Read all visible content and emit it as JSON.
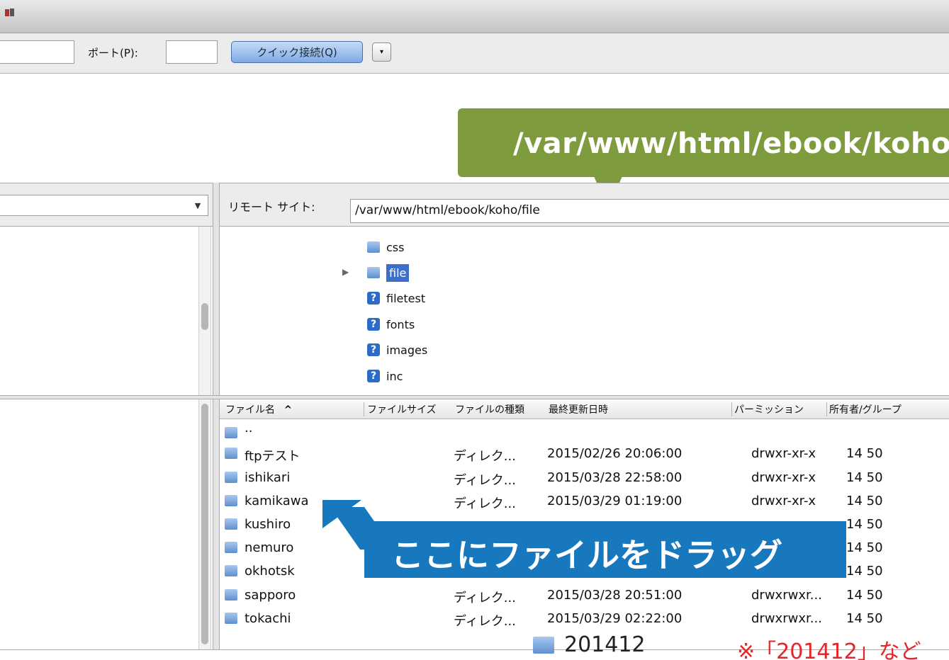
{
  "toolbar": {
    "port_label": "ポート(P):",
    "quickconnect_label": "クイック接続(Q)",
    "dropdown_glyph": "▾"
  },
  "callout_top": {
    "text": "/var/www/html/ebook/koho/"
  },
  "remote_site": {
    "label": "リモート サイト:",
    "path": "/var/www/html/ebook/koho/file"
  },
  "remote_tree": {
    "items": [
      {
        "name": "css",
        "icon": "folder-icon"
      },
      {
        "name": "file",
        "icon": "folder-open-icon",
        "selected": true
      },
      {
        "name": "filetest",
        "icon": "unknown-folder-icon"
      },
      {
        "name": "fonts",
        "icon": "unknown-folder-icon"
      },
      {
        "name": "images",
        "icon": "unknown-folder-icon"
      },
      {
        "name": "inc",
        "icon": "unknown-folder-icon"
      }
    ]
  },
  "columns": {
    "filename": "ファイル名",
    "sort_glyph": "^",
    "filesize": "ファイルサイズ",
    "filetype": "ファイルの種類",
    "modified": "最終更新日時",
    "permission": "パーミッション",
    "owner": "所有者/グループ"
  },
  "files": [
    {
      "name": "..",
      "type": "",
      "modified": "",
      "perm": "",
      "owner": ""
    },
    {
      "name": "ftpテスト",
      "type": "ディレク...",
      "modified": "2015/02/26 20:06:00",
      "perm": "drwxr-xr-x",
      "owner": "14 50"
    },
    {
      "name": "ishikari",
      "type": "ディレク...",
      "modified": "2015/03/28 22:58:00",
      "perm": "drwxr-xr-x",
      "owner": "14 50"
    },
    {
      "name": "kamikawa",
      "type": "ディレク...",
      "modified": "2015/03/29 01:19:00",
      "perm": "drwxr-xr-x",
      "owner": "14 50"
    },
    {
      "name": "kushiro",
      "type": "",
      "modified": "",
      "perm": "",
      "owner": "14 50"
    },
    {
      "name": "nemuro",
      "type": "",
      "modified": "",
      "perm": "",
      "owner": "14 50"
    },
    {
      "name": "okhotsk",
      "type": "",
      "modified": "",
      "perm": "",
      "owner": "14 50"
    },
    {
      "name": "sapporo",
      "type": "ディレク...",
      "modified": "2015/03/28 20:51:00",
      "perm": "drwxrwxr...",
      "owner": "14 50"
    },
    {
      "name": "tokachi",
      "type": "ディレク...",
      "modified": "2015/03/29 02:22:00",
      "perm": "drwxrwxr...",
      "owner": "14 50"
    }
  ],
  "callout_drag": {
    "text": "ここにファイルをドラッグ"
  },
  "caption": {
    "folder_name": "201412",
    "note": "※「201412」など"
  },
  "colors": {
    "green_callout": "#7e9b3e",
    "blue_callout": "#1778be",
    "note_red": "#e3262c",
    "selection": "#3b6fc9"
  }
}
